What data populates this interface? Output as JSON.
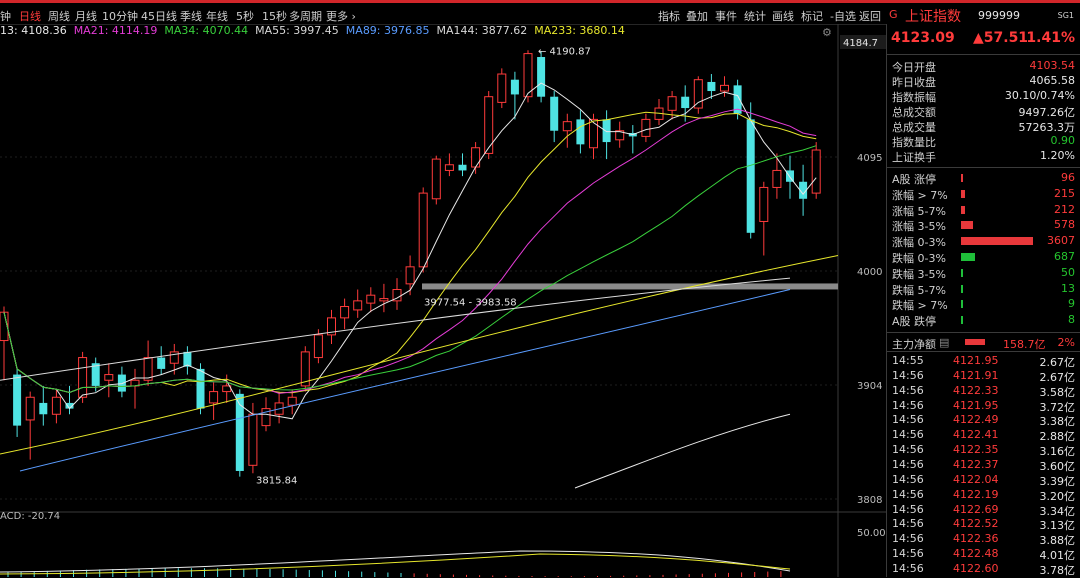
{
  "period_tabs": [
    "钟",
    "日线",
    "周线",
    "月线",
    "10分钟",
    "45日线",
    "季线",
    "年线",
    "5秒",
    "15秒",
    "多周期",
    "更多 ›"
  ],
  "active_tab": "日线",
  "toolbar": [
    "指标",
    "叠加",
    "事件",
    "统计",
    "画线",
    "标记",
    "-自选",
    "返回"
  ],
  "stock": {
    "marker": "G",
    "name": "上证指数",
    "code": "999999",
    "badge": "SG1",
    "price": "4123.09",
    "change": "▲57.51",
    "pct": "1.41%"
  },
  "ma_line": [
    {
      "label": "13: 4108.36",
      "color": "#e8e8e8"
    },
    {
      "label": "MA21: 4114.19",
      "color": "#e43cd6"
    },
    {
      "label": "MA34: 4070.44",
      "color": "#39d03c"
    },
    {
      "label": "MA55: 3997.45",
      "color": "#d8d8d8"
    },
    {
      "label": "MA89: 3976.85",
      "color": "#5a9cff"
    },
    {
      "label": "MA144: 3877.62",
      "color": "#d8d8d8"
    },
    {
      "label": "MA233: 3680.14",
      "color": "#e6e62c"
    }
  ],
  "price_axis": {
    "current": "4184.7",
    "ticks": [
      "4095",
      "4000",
      "3904",
      "3808"
    ],
    "macd_tick": "50.00"
  },
  "annotations": {
    "high": "4190.87",
    "low": "3815.84",
    "gap": "3977.54 - 3983.58",
    "macd": "ACD: -20.74"
  },
  "stats": [
    {
      "k": "今日开盘",
      "v": "4103.54",
      "c": "red"
    },
    {
      "k": "昨日收盘",
      "v": "4065.58",
      "c": "white"
    },
    {
      "k": "指数振幅",
      "v": "30.10/0.74%",
      "c": "white"
    },
    {
      "k": "总成交额",
      "v": "9497.26亿",
      "c": "white"
    },
    {
      "k": "总成交量",
      "v": "57263.3万",
      "c": "white"
    },
    {
      "k": "指数量比",
      "v": "0.90",
      "c": "green"
    },
    {
      "k": "上证换手",
      "v": "1.20%",
      "c": "white"
    }
  ],
  "breadth": [
    {
      "k": "A股 涨停",
      "v": "96",
      "c": "red",
      "frac": 0.03
    },
    {
      "k": "涨幅 > 7%",
      "v": "215",
      "c": "red",
      "frac": 0.06
    },
    {
      "k": "涨幅 5-7%",
      "v": "212",
      "c": "red",
      "frac": 0.06
    },
    {
      "k": "涨幅 3-5%",
      "v": "578",
      "c": "red",
      "frac": 0.16
    },
    {
      "k": "涨幅 0-3%",
      "v": "3607",
      "c": "red",
      "frac": 1.0
    },
    {
      "k": "跌幅 0-3%",
      "v": "687",
      "c": "green",
      "frac": 0.19
    },
    {
      "k": "跌幅 3-5%",
      "v": "50",
      "c": "green",
      "frac": 0.02
    },
    {
      "k": "跌幅 5-7%",
      "v": "13",
      "c": "green",
      "frac": 0.01
    },
    {
      "k": "跌幅 > 7%",
      "v": "9",
      "c": "green",
      "frac": 0.01
    },
    {
      "k": "A股 跌停",
      "v": "8",
      "c": "green",
      "frac": 0.01
    }
  ],
  "netflow": {
    "label": "主力净额",
    "value": "158.7亿",
    "pct": "2%"
  },
  "ticks": [
    {
      "t": "14:55",
      "p": "4121.95",
      "a": "2.67亿"
    },
    {
      "t": "14:56",
      "p": "4121.91",
      "a": "2.67亿"
    },
    {
      "t": "14:56",
      "p": "4122.33",
      "a": "3.58亿"
    },
    {
      "t": "14:56",
      "p": "4121.95",
      "a": "3.72亿"
    },
    {
      "t": "14:56",
      "p": "4122.49",
      "a": "3.38亿"
    },
    {
      "t": "14:56",
      "p": "4122.41",
      "a": "2.88亿"
    },
    {
      "t": "14:56",
      "p": "4122.35",
      "a": "3.16亿"
    },
    {
      "t": "14:56",
      "p": "4122.37",
      "a": "3.60亿"
    },
    {
      "t": "14:56",
      "p": "4122.04",
      "a": "3.39亿"
    },
    {
      "t": "14:56",
      "p": "4122.19",
      "a": "3.20亿"
    },
    {
      "t": "14:56",
      "p": "4122.69",
      "a": "3.34亿"
    },
    {
      "t": "14:56",
      "p": "4122.52",
      "a": "3.13亿"
    },
    {
      "t": "14:56",
      "p": "4122.36",
      "a": "3.88亿"
    },
    {
      "t": "14:56",
      "p": "4122.48",
      "a": "4.01亿"
    },
    {
      "t": "14:56",
      "p": "4122.60",
      "a": "3.78亿"
    }
  ],
  "chart_data": {
    "type": "candlestick",
    "price_range": [
      3790,
      4200
    ],
    "candles": [
      [
        3935,
        3960,
        3900,
        3965
      ],
      [
        3905,
        3860,
        3850,
        3910
      ],
      [
        3865,
        3885,
        3830,
        3890
      ],
      [
        3880,
        3870,
        3860,
        3895
      ],
      [
        3870,
        3885,
        3862,
        3892
      ],
      [
        3880,
        3875,
        3870,
        3895
      ],
      [
        3885,
        3920,
        3880,
        3925
      ],
      [
        3915,
        3895,
        3890,
        3920
      ],
      [
        3900,
        3905,
        3885,
        3915
      ],
      [
        3905,
        3890,
        3885,
        3912
      ],
      [
        3895,
        3900,
        3875,
        3910
      ],
      [
        3900,
        3920,
        3895,
        3935
      ],
      [
        3920,
        3910,
        3905,
        3930
      ],
      [
        3915,
        3925,
        3905,
        3932
      ],
      [
        3925,
        3912,
        3905,
        3930
      ],
      [
        3910,
        3875,
        3870,
        3915
      ],
      [
        3880,
        3890,
        3865,
        3898
      ],
      [
        3890,
        3895,
        3880,
        3905
      ],
      [
        3888,
        3820,
        3815,
        3892
      ],
      [
        3825,
        3870,
        3818,
        3880
      ],
      [
        3860,
        3875,
        3855,
        3885
      ],
      [
        3870,
        3880,
        3862,
        3890
      ],
      [
        3878,
        3885,
        3870,
        3892
      ],
      [
        3895,
        3925,
        3890,
        3930
      ],
      [
        3920,
        3940,
        3915,
        3945
      ],
      [
        3940,
        3955,
        3932,
        3962
      ],
      [
        3955,
        3965,
        3945,
        3972
      ],
      [
        3962,
        3970,
        3955,
        3980
      ],
      [
        3968,
        3975,
        3960,
        3982
      ],
      [
        3970,
        3972,
        3960,
        3985
      ],
      [
        3970,
        3980,
        3962,
        3990
      ],
      [
        3985,
        4000,
        3975,
        4010
      ],
      [
        4000,
        4065,
        3995,
        4070
      ],
      [
        4060,
        4095,
        4055,
        4098
      ],
      [
        4085,
        4090,
        4080,
        4100
      ],
      [
        4090,
        4085,
        4080,
        4100
      ],
      [
        4088,
        4105,
        4082,
        4110
      ],
      [
        4100,
        4150,
        4095,
        4155
      ],
      [
        4145,
        4170,
        4140,
        4175
      ],
      [
        4165,
        4152,
        4130,
        4172
      ],
      [
        4150,
        4188,
        4145,
        4191
      ],
      [
        4185,
        4150,
        4145,
        4190
      ],
      [
        4150,
        4120,
        4110,
        4155
      ],
      [
        4120,
        4128,
        4105,
        4135
      ],
      [
        4130,
        4108,
        4100,
        4138
      ],
      [
        4105,
        4130,
        4095,
        4135
      ],
      [
        4130,
        4110,
        4095,
        4138
      ],
      [
        4112,
        4120,
        4105,
        4128
      ],
      [
        4118,
        4115,
        4100,
        4125
      ],
      [
        4115,
        4130,
        4110,
        4135
      ],
      [
        4130,
        4140,
        4125,
        4148
      ],
      [
        4138,
        4150,
        4130,
        4155
      ],
      [
        4150,
        4140,
        4128,
        4160
      ],
      [
        4140,
        4165,
        4135,
        4168
      ],
      [
        4163,
        4155,
        4148,
        4170
      ],
      [
        4155,
        4160,
        4150,
        4168
      ],
      [
        4160,
        4135,
        4130,
        4165
      ],
      [
        4130,
        4030,
        4025,
        4145
      ],
      [
        4040,
        4070,
        4010,
        4075
      ],
      [
        4070,
        4085,
        4060,
        4100
      ],
      [
        4085,
        4075,
        4060,
        4098
      ],
      [
        4075,
        4060,
        4045,
        4090
      ],
      [
        4065,
        4103,
        4060,
        4110
      ]
    ]
  }
}
